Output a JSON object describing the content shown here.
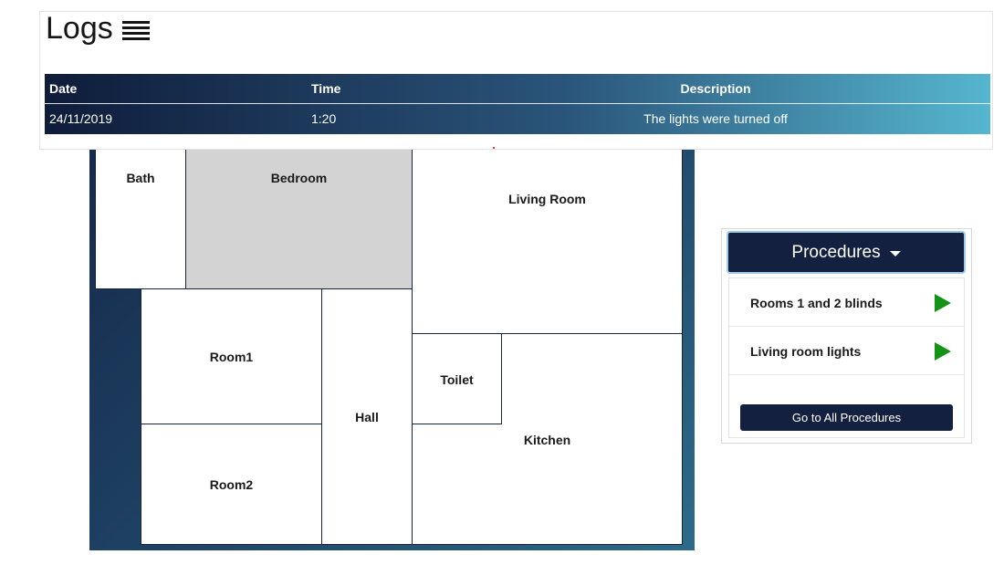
{
  "logs": {
    "title": "Logs",
    "columns": {
      "date": "Date",
      "time": "Time",
      "description": "Description"
    },
    "rows": [
      {
        "date": "24/11/2019",
        "time": "1:20",
        "description": "The lights were turned off"
      }
    ]
  },
  "floorplan": {
    "rooms": {
      "bath": "Bath",
      "bedroom": "Bedroom",
      "living_room": "Living Room",
      "room1": "Room1",
      "room2": "Room2",
      "hall": "Hall",
      "toilet": "Toilet",
      "kitchen": "Kitchen"
    },
    "selected_room": "bedroom"
  },
  "procedures": {
    "title": "Procedures",
    "items": [
      {
        "label": "Rooms 1 and 2 blinds",
        "icon": "play-icon"
      },
      {
        "label": "Living room lights",
        "icon": "play-icon"
      }
    ],
    "go_all_label": "Go to All Procedures"
  },
  "colors": {
    "navy": "#13203f",
    "play_green": "#149414",
    "selected_room": "#d3d3d3",
    "gradient_end": "#56b6cf"
  }
}
